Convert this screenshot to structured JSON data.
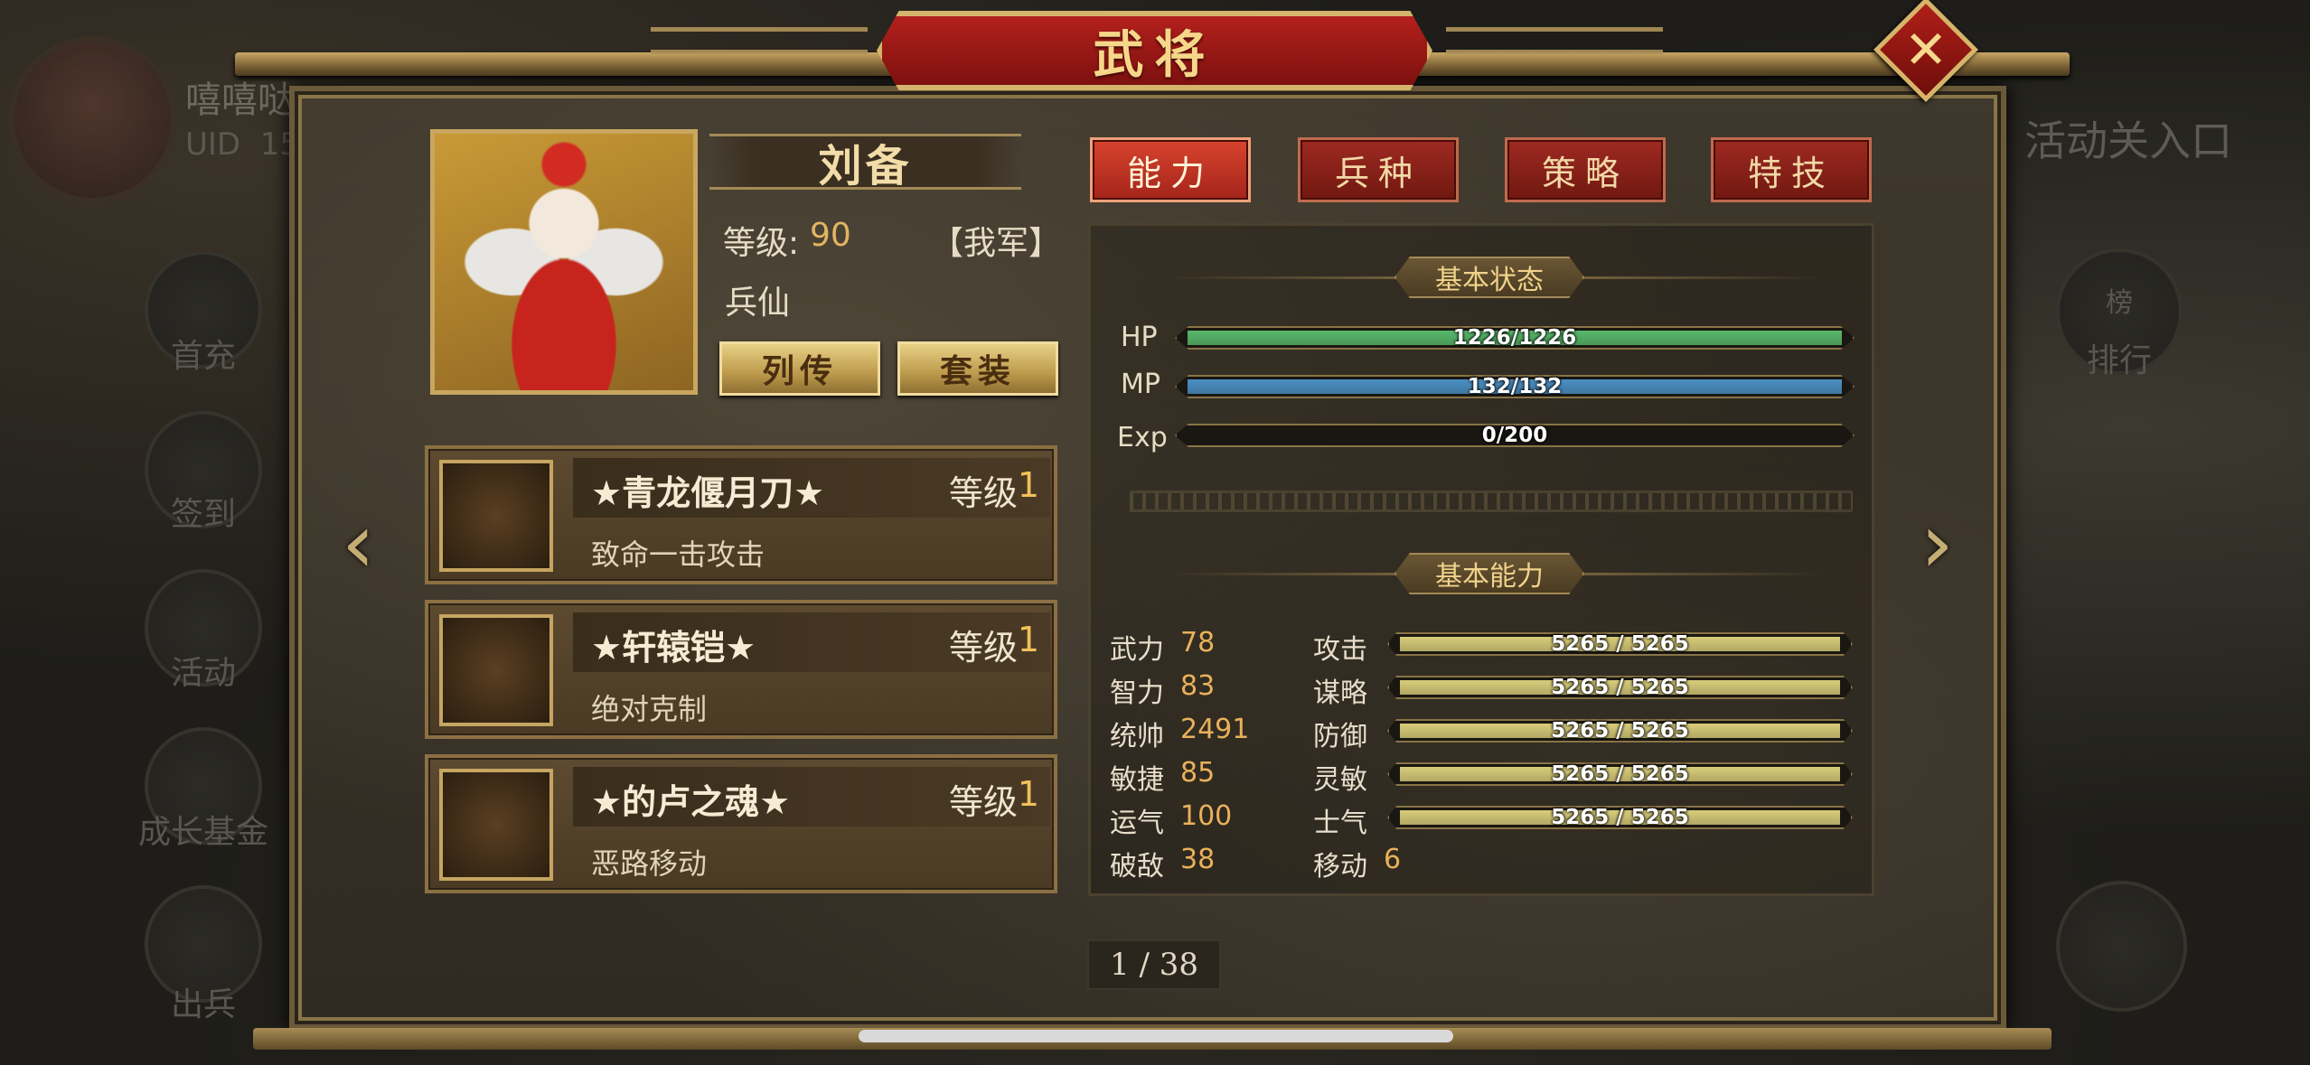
{
  "background": {
    "player_name": "嘻嘻哒",
    "uid_label": "UID",
    "uid_value": "15",
    "side_buttons": [
      "首充",
      "签到",
      "活动",
      "成长基金",
      "出兵"
    ],
    "right_entry": "活动关入口",
    "rank_label": "排行",
    "rank_badge": "榜"
  },
  "title": "武将",
  "general": {
    "name": "刘备",
    "level_label": "等级:",
    "level_value": "90",
    "faction": "【我军】",
    "class_name": "兵仙",
    "buttons": {
      "biography": "列传",
      "set": "套装"
    }
  },
  "equipment": [
    {
      "name": "★青龙偃月刀★",
      "level_label": "等级",
      "level": "1",
      "desc": "致命一击攻击"
    },
    {
      "name": "★轩辕铠★",
      "level_label": "等级",
      "level": "1",
      "desc": "绝对克制"
    },
    {
      "name": "★的卢之魂★",
      "level_label": "等级",
      "level": "1",
      "desc": "恶路移动"
    }
  ],
  "tabs": [
    "能力",
    "兵种",
    "策略",
    "特技"
  ],
  "active_tab": "能力",
  "basic_status": {
    "title": "基本状态",
    "bars": [
      {
        "label": "HP",
        "text": "1226/1226",
        "fill": 1.0,
        "color": "#57b86a"
      },
      {
        "label": "MP",
        "text": "132/132",
        "fill": 1.0,
        "color": "#4a8fc4"
      },
      {
        "label": "Exp",
        "text": "0/200",
        "fill": 0.0,
        "color": "#c9b060"
      }
    ]
  },
  "basic_ability": {
    "title": "基本能力",
    "left": [
      {
        "name": "武力",
        "value": "78"
      },
      {
        "name": "智力",
        "value": "83"
      },
      {
        "name": "统帅",
        "value": "2491"
      },
      {
        "name": "敏捷",
        "value": "85"
      },
      {
        "name": "运气",
        "value": "100"
      },
      {
        "name": "破敌",
        "value": "38"
      }
    ],
    "right": [
      {
        "name": "攻击",
        "text": "5265 / 5265",
        "fill": 1.0
      },
      {
        "name": "谋略",
        "text": "5265 / 5265",
        "fill": 1.0
      },
      {
        "name": "防御",
        "text": "5265 / 5265",
        "fill": 1.0
      },
      {
        "name": "灵敏",
        "text": "5265 / 5265",
        "fill": 1.0
      },
      {
        "name": "士气",
        "text": "5265 / 5265",
        "fill": 1.0
      }
    ],
    "move": {
      "name": "移动",
      "value": "6"
    }
  },
  "pager": "1 / 38",
  "colors": {
    "accent_red": "#b3201c",
    "gold": "#e3b560",
    "ability_bar": "#d8cc7a"
  }
}
